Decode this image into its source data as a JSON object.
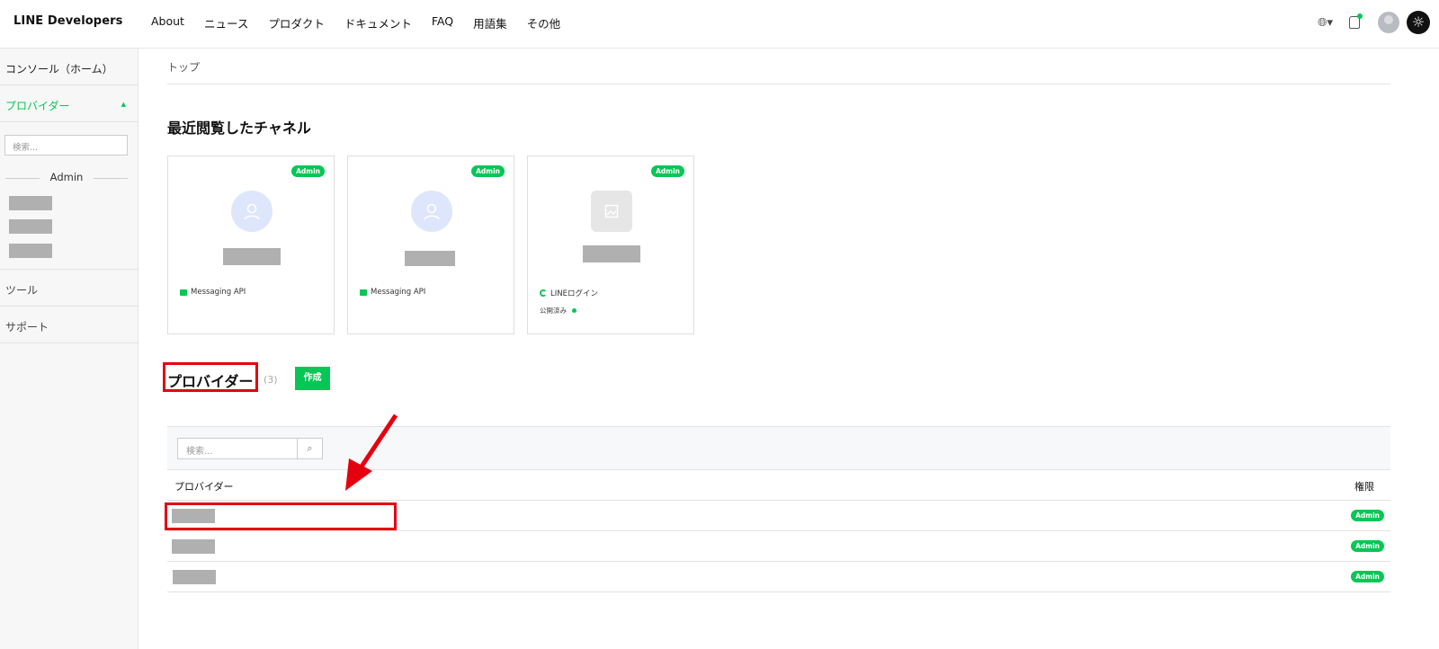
{
  "header": {
    "logo": "LINE Developers",
    "nav": [
      "About",
      "ニュース",
      "プロダクト",
      "ドキュメント",
      "FAQ",
      "用語集",
      "その他"
    ],
    "icons": [
      "globe-icon",
      "notification-icon",
      "avatar",
      "theme-toggle-icon"
    ]
  },
  "sidebar": {
    "console_home": "コンソール（ホーム）",
    "providers": "プロバイダー",
    "search_placeholder": "検索...",
    "admin_label": "Admin",
    "tools": "ツール",
    "support": "サポート"
  },
  "main": {
    "breadcrumb": "トップ",
    "recent_title": "最近閲覧したチャネル",
    "cards": [
      {
        "badge": "Admin",
        "type": "Messaging API",
        "icon": "user-icon"
      },
      {
        "badge": "Admin",
        "type": "Messaging API",
        "icon": "user-icon"
      },
      {
        "badge": "Admin",
        "type": "LINEログイン",
        "icon": "image-icon",
        "status": "公開済み"
      }
    ],
    "providers_title": "プロバイダー",
    "providers_count": "(3)",
    "create_button": "作成",
    "table_search_placeholder": "検索...",
    "col_provider": "プロバイダー",
    "col_permission": "権限",
    "rows": [
      {
        "permission": "Admin"
      },
      {
        "permission": "Admin"
      },
      {
        "permission": "Admin"
      }
    ]
  },
  "colors": {
    "brand_green": "#06c755",
    "highlight_red": "#e4000f"
  }
}
